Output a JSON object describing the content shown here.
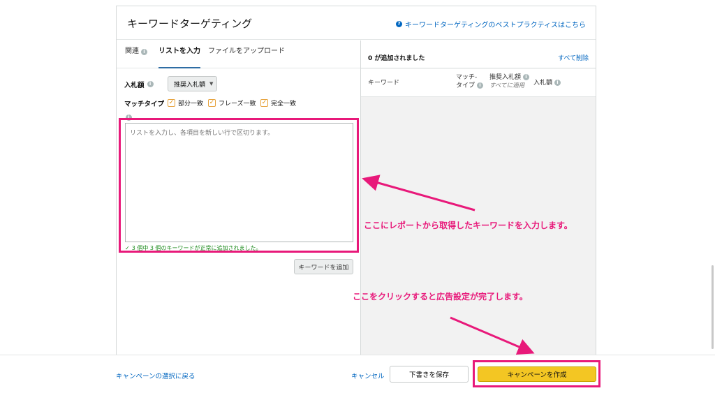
{
  "panel": {
    "title": "キーワードターゲティング",
    "help_link": "キーワードターゲティングのベストプラクティスはこちら"
  },
  "tabs": [
    {
      "label": "関連"
    },
    {
      "label": "リストを入力"
    },
    {
      "label": "ファイルをアップロード"
    }
  ],
  "form": {
    "bid_label": "入札額",
    "bid_select_value": "推奨入札額",
    "match_label": "マッチタイプ",
    "match_options": [
      {
        "label": "部分一致",
        "checked": true
      },
      {
        "label": "フレーズ一致",
        "checked": true
      },
      {
        "label": "完全一致",
        "checked": true
      }
    ],
    "textarea_placeholder": "リストを入力し、各項目を新しい行で区切ります。",
    "success_message": "3 個中 3 個のキーワードが正常に追加されました。",
    "add_button": "キーワードを追加"
  },
  "added": {
    "count_text": "0 が追加されました",
    "clear_all": "すべて削除",
    "columns": {
      "keyword": "キーワード",
      "match_type_line1": "マッチ-",
      "match_type_line2": "タイプ",
      "suggested_bid": "推奨入札額",
      "apply_all": "すべてに適用",
      "bid": "入札額"
    }
  },
  "footer": {
    "back_link": "キャンペーンの選択に戻る",
    "cancel": "キャンセル",
    "save_draft": "下書きを保存",
    "create": "キャンペーンを作成"
  },
  "annotations": {
    "input_note": "ここにレポートから取得したキーワードを入力します。",
    "create_note": "ここをクリックすると広告設定が完了します。"
  },
  "colors": {
    "annotation": "#e8197a",
    "link": "#0066c0",
    "primary_button": "#f3c623",
    "success": "#1a8a1a",
    "checkbox": "#e08a00"
  },
  "icons": [
    "info-icon",
    "help-icon",
    "check-icon",
    "chevron-down-icon",
    "arrow-icon"
  ]
}
